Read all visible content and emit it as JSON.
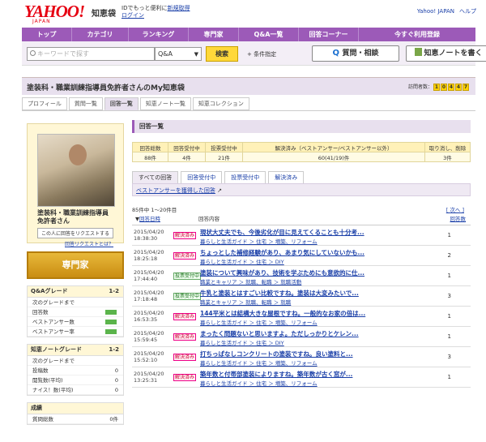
{
  "header": {
    "logo": "YAHOO!",
    "logo_sub": "JAPAN",
    "service": "知恵袋",
    "tagline_pre": "IDでもっと便利に",
    "register": "新規取得",
    "login": "ログイン",
    "right_links": [
      "Yahoo! JAPAN",
      "ヘルプ"
    ]
  },
  "nav": [
    "トップ",
    "カテゴリ",
    "ランキング",
    "専門家",
    "Q&A一覧",
    "回答コーナー",
    "今すぐ利用登録"
  ],
  "search": {
    "placeholder": "キーワードで探す",
    "select_value": "Q&A",
    "search_button": "検索",
    "conditions": "条件指定",
    "ask_button": "質問・相談",
    "note_button": "知恵ノートを書く"
  },
  "profile": {
    "title": "塗装科・職業訓練指導員免許者さんのMy知恵袋",
    "visitor_label": "訪問者数：",
    "visitor_digits": [
      "1",
      "0",
      "4",
      "4",
      "7"
    ],
    "tabs": [
      "プロフィール",
      "質問一覧",
      "回答一覧",
      "知恵ノート一覧",
      "知恵コレクション"
    ],
    "name": "塗装科・職業訓練指導員免許者さん",
    "request_button": "この人に回答をリクエストする",
    "request_help": "回答リクエストとは？",
    "expert_badge": "専門家"
  },
  "qa_grade": {
    "title": "Q&Aグレード",
    "level": "1-2",
    "rows": [
      "次のグレードまで",
      "回答数",
      "ベストアンサー数",
      "ベストアンサー率"
    ]
  },
  "note_grade": {
    "title": "知恵ノートグレード",
    "level": "1-2",
    "rows": [
      "次のグレードまで",
      "投稿数",
      "閲覧数(平均)",
      "ナイス！数(平均)"
    ],
    "values": [
      "",
      "0",
      "0",
      "0"
    ]
  },
  "achievements": {
    "title": "成績",
    "row_label": "質問総数",
    "row_value": "0件"
  },
  "section_title": "回答一覧",
  "stats": {
    "headers": [
      "回答総数",
      "回答受付中",
      "投票受付中",
      "解決済み（ベストアンサー/ベストアンサー以外）",
      "取り消し、削除"
    ],
    "values": [
      "88件",
      "4件",
      "21件",
      "60(41/19)件",
      "3件"
    ]
  },
  "answer_tabs": [
    "すべての回答",
    "回答受付中",
    "投票受付中",
    "解決済み"
  ],
  "best_answer_link": "ベストアンサーを獲得した回答",
  "count_text": "85件中 1～20件目",
  "next_link": "次へ",
  "columns": {
    "date": "回答日時",
    "content": "回答内容",
    "answers": "回答数"
  },
  "rows": [
    {
      "date": "2015/04/20",
      "time": "18:38:30",
      "status": "解決済み",
      "title": "現状大丈夫でも、今後劣化が目に見えてくることも十分考...",
      "category": "暮らしと生活ガイド ＞ 住宅 ＞ 増築、リフォーム",
      "count": "1"
    },
    {
      "date": "2015/04/20",
      "time": "18:25:18",
      "status": "解決済み",
      "title": "ちょっとした補修経験があり、あまり気にしていないかも...",
      "category": "暮らしと生活ガイド ＞ 住宅 ＞ DIY",
      "count": "2"
    },
    {
      "date": "2015/04/20",
      "time": "17:44:40",
      "status": "投票受付中",
      "title": "塗装について興味があり、技術を学ぶためにも意欲的に仕...",
      "category": "職業とキャリア ＞ 就職、転職 ＞ 就職活動",
      "count": "1"
    },
    {
      "date": "2015/04/20",
      "time": "17:18:48",
      "status": "投票受付中",
      "title": "牛乳と塗装とはすごい比較ですね。塗装は大変みたいで...",
      "category": "職業とキャリア ＞ 就職、転職 ＞ 就職",
      "count": "3"
    },
    {
      "date": "2015/04/20",
      "time": "16:53:35",
      "status": "解決済み",
      "title": "144平米とは結構大きな屋根ですね。一般的なお家の倍は...",
      "category": "暮らしと生活ガイド ＞ 住宅 ＞ 増築、リフォーム",
      "count": "1"
    },
    {
      "date": "2015/04/20",
      "time": "15:59:45",
      "status": "解決済み",
      "title": "まったく問題ないと思いますよ。ただしっかりとケレン...",
      "category": "暮らしと生活ガイド ＞ 住宅 ＞ DIY",
      "count": "1"
    },
    {
      "date": "2015/04/20",
      "time": "15:52:10",
      "status": "解決済み",
      "title": "打ちっぱなしコンクリートの塗装ですね。良い塗料と...",
      "category": "暮らしと生活ガイド ＞ 住宅 ＞ 増築、リフォーム",
      "count": "3"
    },
    {
      "date": "2015/04/20",
      "time": "13:25:31",
      "status": "解決済み",
      "title": "築年数と付帯部塗装によりますね。築年数が古く窓が...",
      "category": "暮らしと生活ガイド ＞ 住宅 ＞ 増築、リフォーム",
      "count": "1"
    }
  ]
}
